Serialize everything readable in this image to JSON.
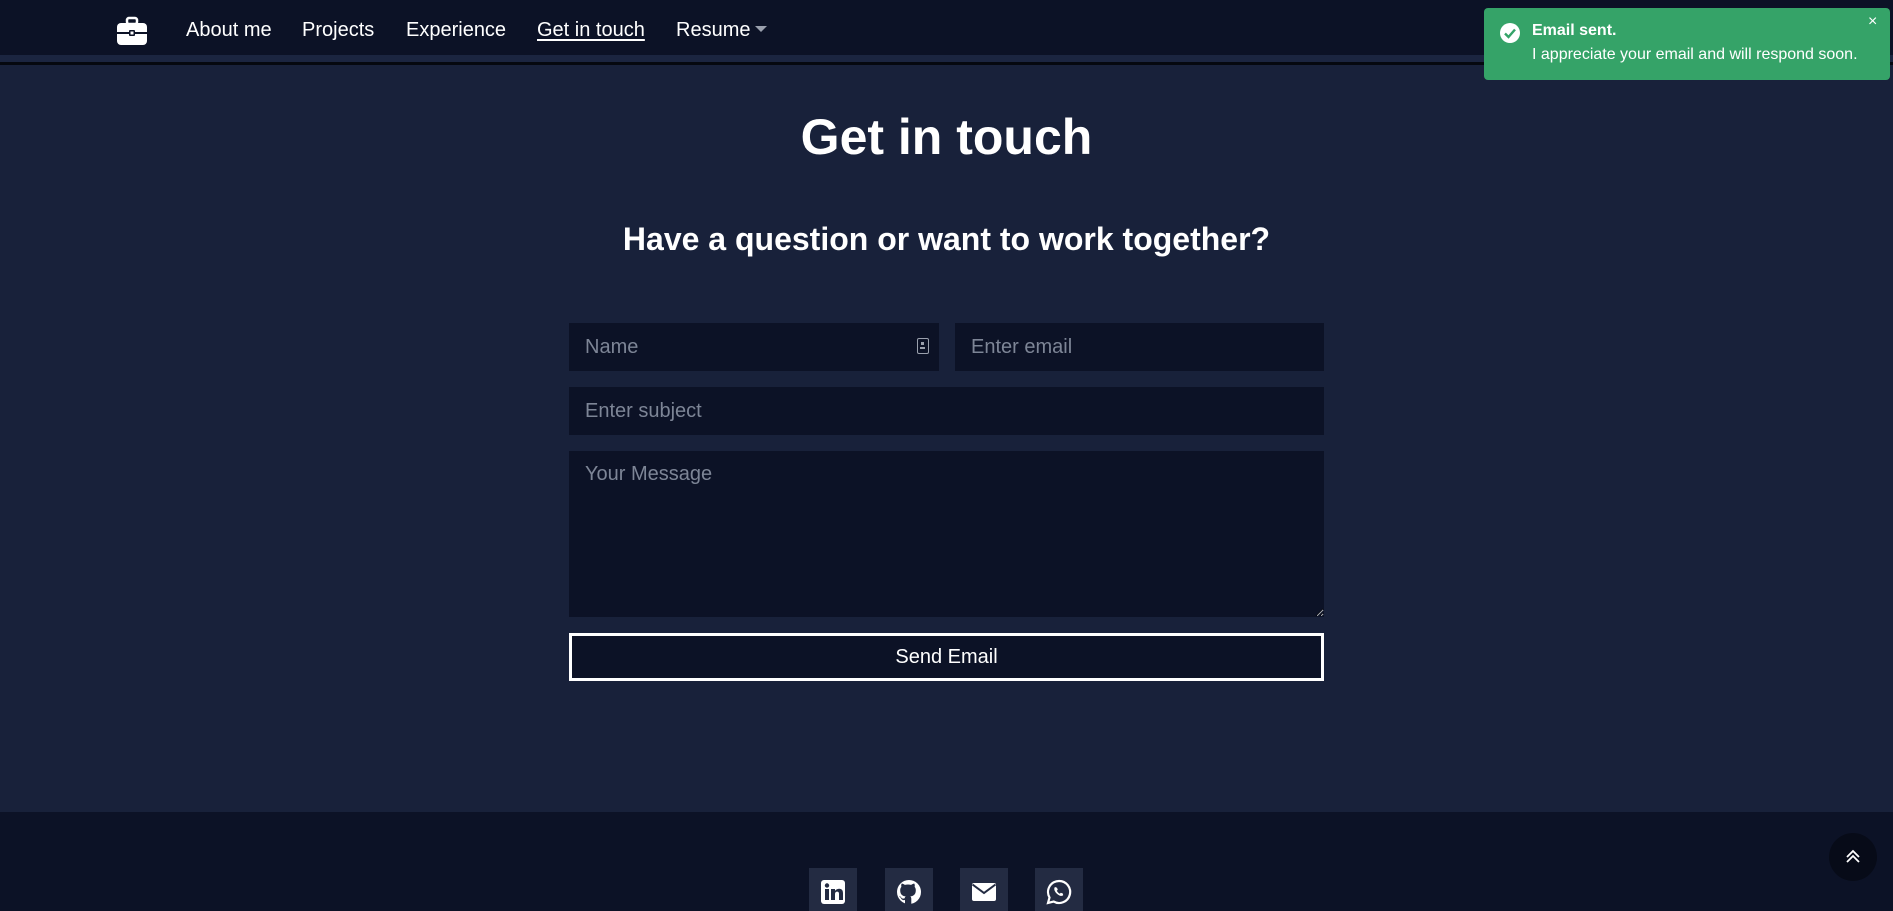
{
  "nav": {
    "links": [
      {
        "label": "About me"
      },
      {
        "label": "Projects"
      },
      {
        "label": "Experience"
      },
      {
        "label": "Get in touch",
        "active": true
      },
      {
        "label": "Resume",
        "dropdown": true
      }
    ]
  },
  "contact": {
    "title": "Get in touch",
    "subtitle": "Have a question or want to work together?",
    "fields": {
      "name_placeholder": "Name",
      "email_placeholder": "Enter email",
      "subject_placeholder": "Enter subject",
      "message_placeholder": "Your Message"
    },
    "send_label": "Send Email"
  },
  "footer": {
    "social_icons": [
      "linkedin-icon",
      "github-icon",
      "envelope-icon",
      "whatsapp-icon"
    ]
  },
  "toast": {
    "title": "Email sent.",
    "message": "I appreciate your email and will respond soon.",
    "close_symbol": "×",
    "color": "#35a368"
  },
  "colors": {
    "background": "#18213a",
    "navbar": "#0c1226",
    "field": "#0c1226"
  }
}
